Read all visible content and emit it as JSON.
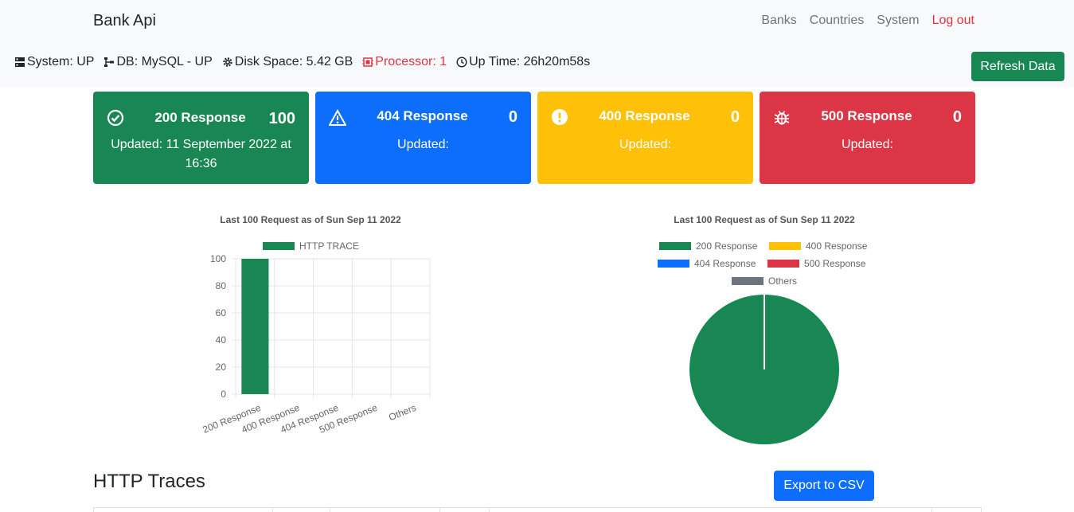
{
  "header": {
    "brand": "Bank Api",
    "nav": [
      {
        "label": "Banks"
      },
      {
        "label": "Countries"
      },
      {
        "label": "System"
      },
      {
        "label": "Log out"
      }
    ]
  },
  "status": {
    "system": "System: UP",
    "db": "DB: MySQL - UP",
    "disk": "Disk Space: 5.42 GB",
    "processor": "Processor: 1",
    "uptime": "Up Time: 26h20m58s",
    "refresh_label": "Refresh Data"
  },
  "cards": [
    {
      "title": "200 Response",
      "count": "100",
      "updated": "Updated: 11 September 2022 at 16:36",
      "color": "#198754",
      "icon": "check-circle-icon"
    },
    {
      "title": "404 Response",
      "count": "0",
      "updated": "Updated:",
      "color": "#0d6efd",
      "icon": "warning-triangle-icon"
    },
    {
      "title": "400 Response",
      "count": "0",
      "updated": "Updated:",
      "color": "#ffc107",
      "icon": "exclamation-circle-icon"
    },
    {
      "title": "500 Response",
      "count": "0",
      "updated": "Updated:",
      "color": "#dc3545",
      "icon": "bug-icon"
    }
  ],
  "chart_data": [
    {
      "type": "bar",
      "title": "Last 100 Request as of Sun Sep 11 2022",
      "categories": [
        "200 Response",
        "400 Response",
        "404 Response",
        "500 Response",
        "Others"
      ],
      "series": [
        {
          "name": "HTTP TRACE",
          "values": [
            100,
            0,
            0,
            0,
            0
          ],
          "color": "#198754"
        }
      ],
      "ylim": [
        0,
        100
      ],
      "yticks": [
        "0",
        "20",
        "40",
        "60",
        "80",
        "100"
      ],
      "grid": true,
      "legend": "top"
    },
    {
      "type": "pie",
      "title": "Last 100 Request as of Sun Sep 11 2022",
      "labels": [
        "200 Response",
        "400 Response",
        "404 Response",
        "500 Response",
        "Others"
      ],
      "values": [
        100,
        0,
        0,
        0,
        0
      ],
      "colors": [
        "#198754",
        "#ffc107",
        "#0d6efd",
        "#dc3545",
        "#6c757d"
      ],
      "legend": "top"
    }
  ],
  "traces": {
    "title": "HTTP Traces",
    "export_label": "Export to CSV"
  }
}
